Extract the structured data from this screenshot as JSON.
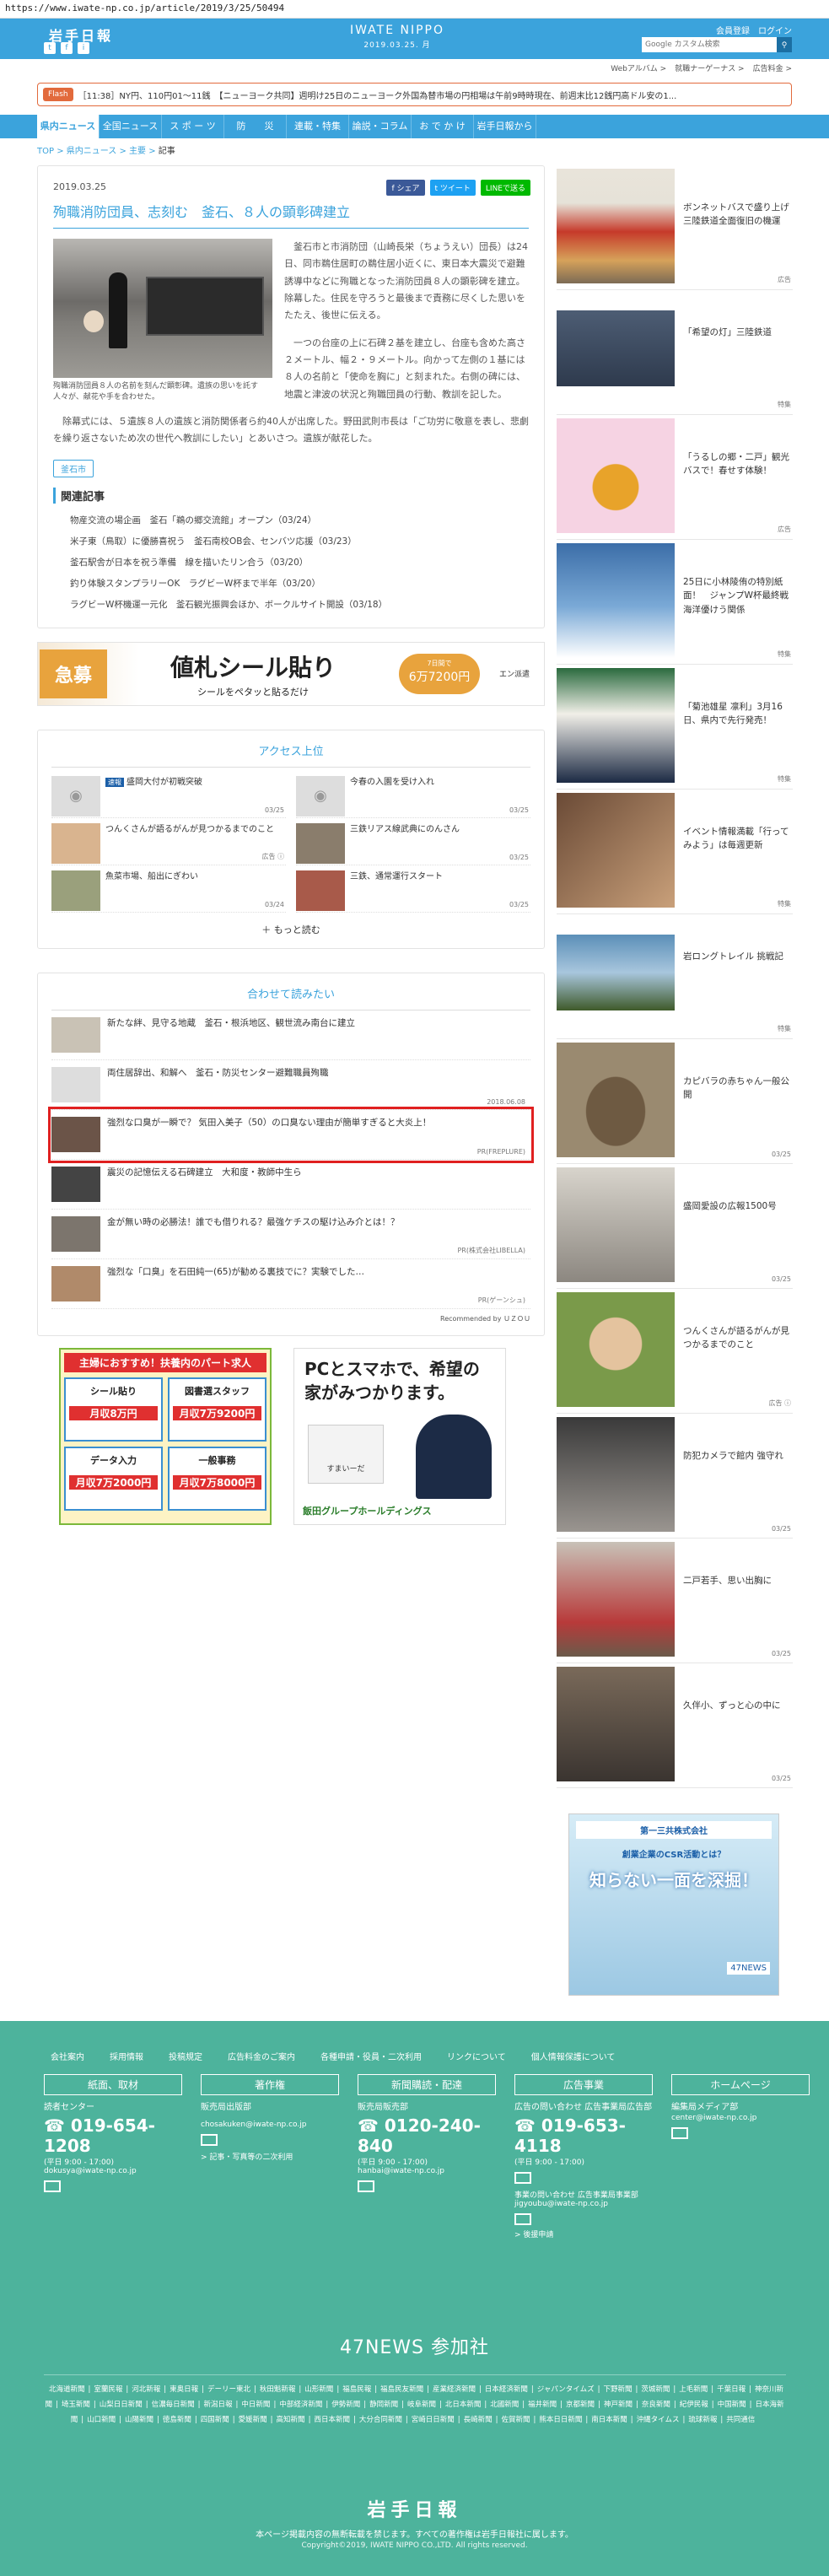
{
  "url": "https://www.iwate-np.co.jp/article/2019/3/25/50494",
  "header": {
    "logo": "岩手日報",
    "site": "IWATE NIPPO",
    "date": "2019.03.25. 月",
    "login_links": "会員登録　ログイン",
    "search_placeholder": "Google カスタム検索",
    "social": [
      "t",
      "f",
      "i"
    ]
  },
  "subnav": [
    "Webアルバム >",
    "就職ナーゲーナス >",
    "広告料金 >"
  ],
  "ticker": {
    "label": "Flash",
    "text": "［11:38］NY円、110円01～11銭　【ニューヨーク共同】週明け25日のニューヨーク外国為替市場の円相場は午前9時時現在、前週末比12銭円高ドル安の1..."
  },
  "gnav": [
    "県内ニュース",
    "全国ニュース",
    "ス ポ ー ツ",
    "防　　災",
    "連載・特集",
    "論説・コラム",
    "お で か け",
    "岩手日報から"
  ],
  "breadcrumb": {
    "top": "TOP",
    "sep": " > ",
    "c1": "県内ニュース",
    "c2": "主要",
    "current": "記事"
  },
  "article": {
    "date": "2019.03.25",
    "share": [
      "f シェア",
      "t ツイート",
      "LINEで送る"
    ],
    "title": "殉職消防団員、志刻む　釜石、８人の顕彰碑建立",
    "caption": "殉職消防団員８人の名前を刻んだ顕彰碑。遺族の思いを託す人々が、献花や手を合わせた。",
    "p1": "釜石市と市消防団（山崎長栄（ちょうえい）団長）は24日、同市鵜住居町の鵜住居小近くに、東日本大震災で避難誘導中などに殉職となった消防団員８人の顕彰碑を建立。除幕した。住民を守ろうと最後まで責務に尽くした思いをたたえ、後世に伝える。",
    "p2": "一つの台座の上に石碑２基を建立し、台座も含めた高さ２メートル、幅２・９メートル。向かって左側の１基には８人の名前と「使命を胸に」と刻まれた。右側の碑には、地震と津波の状況と殉職団員の行動、教訓を記した。",
    "p3": "除幕式には、５遺族８人の遺族と消防関係者ら約40人が出席した。野田武則市長は「ご功労に敬意を表し、悲劇を繰り返さないため次の世代へ教訓にしたい」とあいさつ。遺族が献花した。",
    "tag": "釜石市",
    "related_title": "関連記事",
    "related": [
      "物産交流の場企画　釜石「鵜の郷交流館」オープン（03/24）",
      "米子東（鳥取）に優勝喜祝う　釜石南校OB会、センバツ応援（03/23）",
      "釜石駅舎が日本を祝う準備　線を描いたリン合う（03/20）",
      "釣り体験スタンプラリーOK　ラグビーW杯まで半年（03/20）",
      "ラグビーW杯機運一元化　釜石観光振興会ほか、ボークルサイト開設（03/18）"
    ]
  },
  "banner": {
    "left": "急募",
    "main": "値札シール貼り",
    "sub": "シールをペタッと貼るだけ",
    "pill_top": "7日間で",
    "pill_main": "6万7200円",
    "brand": "エン派遣"
  },
  "access": {
    "title": "アクセス上位",
    "items": [
      {
        "badge": "速報",
        "text": "盛岡大付が初戦突破",
        "date": "03/25"
      },
      {
        "badge": "",
        "text": "今春の入園を受け入れ",
        "date": "03/25"
      },
      {
        "badge": "",
        "text": "つんくさんが語るがんが見つかるまでのこと",
        "date": "広告 ⓘ"
      },
      {
        "badge": "",
        "text": "三鉄リアス線武典にのんさん",
        "date": "03/25"
      },
      {
        "badge": "",
        "text": "魚菜市場、船出にぎわい",
        "date": "03/24"
      },
      {
        "badge": "",
        "text": "三鉄、通常運行スタート",
        "date": "03/25"
      }
    ],
    "more": "もっと読む"
  },
  "reco": {
    "title": "合わせて読みたい",
    "items": [
      {
        "text": "新たな絆、見守る地蔵　釜石・根浜地区、観世流み南台に建立",
        "meta": ""
      },
      {
        "text": "両住居辞出、和解へ　釜石・防災センター避難職員殉職",
        "meta": "2018.06.08"
      },
      {
        "text": "強烈な口臭が一瞬で？ 気田入美子（50）の口臭ない理由が簡単すぎると大炎上！",
        "meta": "PR(FREPLURE)"
      },
      {
        "text": "震災の記憶伝える石碑建立　大和度・教師中生ら",
        "meta": ""
      },
      {
        "text": "金が無い時の必勝法！誰でも借りれる？最強ケチスの駆け込み介とは！？",
        "meta": "PR(株式会社LIBELLA)"
      },
      {
        "text": "強烈な「口臭」を石田純一(65)が勧める裏技でに？実験でした…",
        "meta": "PR(ゲーンシュ)"
      }
    ],
    "footer": "Recommended by ＵＺＯＵ"
  },
  "ad_jobs": {
    "title": "主婦におすすめ！扶養内のパート求人",
    "cells": [
      {
        "h": "シール貼り",
        "p": "月収8万円"
      },
      {
        "h": "図書選スタッフ",
        "p": "月収7万9200円"
      },
      {
        "h": "データ入力",
        "p": "月収7万2000円"
      },
      {
        "h": "一般事務",
        "p": "月収7万8000円"
      }
    ]
  },
  "ad_home": {
    "headline": "PCとスマホで、希望の家がみつかります。",
    "brand": "飯田グループホールディングス",
    "sub": "すまいーだ"
  },
  "sidebar": [
    {
      "text": "ボンネットバスで盛り上げ 三陸鉄道全面復旧の機運",
      "tag": "広告",
      "img": "bus"
    },
    {
      "text": "「希望の灯」三陸鉄道",
      "tag": "特集",
      "img": "rail"
    },
    {
      "text": "「うるしの郷・二戸」観光バスで！春せす体験！",
      "tag": "広告",
      "img": "festival"
    },
    {
      "text": "25日に小林陵侑の特別紙面！　ジャンプW杯最終戦 海洋優けう関係",
      "tag": "特集",
      "img": "ski"
    },
    {
      "text": "「菊池雄星 凛利」3月16日、県内で先行発売！",
      "tag": "特集",
      "img": "kikuchi"
    },
    {
      "text": "イベント情報満載「行ってみよう」は毎週更新",
      "tag": "特集",
      "img": "event"
    },
    {
      "text": "岩ロングトレイル 挑戦記",
      "tag": "特集",
      "img": "trail"
    },
    {
      "text": "カピバラの赤ちゃん一般公開",
      "tag": "03/25",
      "img": "capybara"
    },
    {
      "text": "盛岡愛設の広報1500号",
      "tag": "03/25",
      "img": "news"
    },
    {
      "text": "つんくさんが語るがんが見つかるまでのこと",
      "tag": "広告 ⓘ",
      "img": "person"
    },
    {
      "text": "防犯カメラで館内 強守れ",
      "tag": "03/25",
      "img": "camera"
    },
    {
      "text": "二戸若手、思い出胸に",
      "tag": "03/25",
      "img": "school"
    },
    {
      "text": "久伴小、ずっと心の中に",
      "tag": "03/25",
      "img": "class"
    }
  ],
  "side_ad": {
    "label": "第一三共株式会社",
    "headline": "知らない一面を深掘！",
    "sub": "創業企業のCSR活動とは？",
    "brand": "47NEWS"
  },
  "footer": {
    "links": [
      "会社案内",
      "採用情報",
      "投稿規定",
      "広告料金のご案内",
      "各種申請・役員・二次利用",
      "リンクについて",
      "個人情報保護について"
    ],
    "cols": [
      {
        "head": "紙面、取材",
        "l1": "読者センター",
        "phone": "019-654-1208",
        "hours": "(平日 9:00 - 17:00)",
        "mail": "dokusya@iwate-np.co.jp"
      },
      {
        "head": "著作権",
        "l1": "販売局出版部",
        "phone": "",
        "hours": "",
        "mail": "chosakuken@iwate-np.co.jp",
        "extra": "> 記事・写真等の二次利用"
      },
      {
        "head": "新聞購読・配達",
        "l1": "販売局販売部",
        "phone": "0120-240-840",
        "hours": "(平日 9:00 - 17:00)",
        "mail": "hanbai@iwate-np.co.jp"
      },
      {
        "head": "広告事業",
        "l1": "広告の問い合わせ 広告事業局広告部",
        "phone": "019-653-4118",
        "hours": "(平日 9:00 - 17:00)",
        "mail": "事業の問い合わせ 広告事業局事業部 jigyoubu@iwate-np.co.jp",
        "extra": "> 後援申請"
      },
      {
        "head": "ホームページ",
        "l1": "編集局メディア部",
        "phone": "",
        "hours": "",
        "mail": "center@iwate-np.co.jp"
      }
    ],
    "news47_title": "47NEWS 参加社",
    "news47": [
      "北海道新聞",
      "室蘭民報",
      "河北新報",
      "東奥日報",
      "デーリー東北",
      "秋田魁新報",
      "山形新聞",
      "福島民報",
      "福島民友新聞",
      "産業経済新聞",
      "日本経済新聞",
      "ジャパンタイムズ",
      "下野新聞",
      "茨城新聞",
      "上毛新聞",
      "千葉日報",
      "神奈川新聞",
      "埼玉新聞",
      "山梨日日新聞",
      "信濃毎日新聞",
      "新潟日報",
      "中日新聞",
      "中部経済新聞",
      "伊勢新聞",
      "静岡新聞",
      "岐阜新聞",
      "北日本新聞",
      "北國新聞",
      "福井新聞",
      "京都新聞",
      "神戸新聞",
      "奈良新聞",
      "紀伊民報",
      "中国新聞",
      "日本海新聞",
      "山口新聞",
      "山陽新聞",
      "徳島新聞",
      "四国新聞",
      "愛媛新聞",
      "高知新聞",
      "西日本新聞",
      "大分合同新聞",
      "宮崎日日新聞",
      "長崎新聞",
      "佐賀新聞",
      "熊本日日新聞",
      "南日本新聞",
      "沖縄タイムス",
      "琉球新報",
      "共同通信"
    ],
    "logo": "岩手日報",
    "c1": "本ページ掲載内容の無断転載を禁じます。すべての著作権は岩手日報社に属します。",
    "c2": "Copyright©2019, IWATE NIPPO CO.,LTD. All rights reserved."
  },
  "colors": {
    "accent": "#3ba3dc",
    "footer": "#4db39c",
    "alert": "#e02020"
  }
}
